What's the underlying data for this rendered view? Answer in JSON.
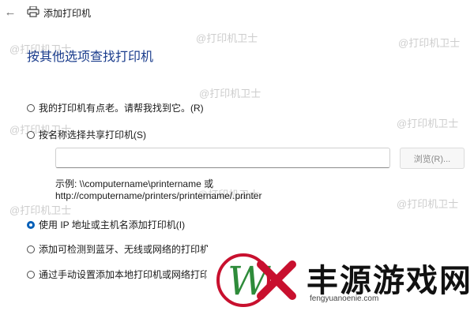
{
  "window": {
    "title": "添加打印机",
    "back_icon": "back-arrow-icon",
    "title_icon": "printer-icon"
  },
  "heading": "按其他选项查找打印机",
  "options": [
    {
      "label": "我的打印机有点老。请帮我找到它。(R)",
      "checked": false
    },
    {
      "label": "按名称选择共享打印机(S)",
      "checked": false
    },
    {
      "label": "使用 IP 地址或主机名添加打印机(I)",
      "checked": true
    },
    {
      "label": "添加可检测到蓝牙、无线或网络的打印机",
      "checked": false
    },
    {
      "label": "通过手动设置添加本地打印机或网络打印机",
      "checked": false
    }
  ],
  "shared_printer": {
    "input_value": "",
    "browse_label": "浏览(R)...",
    "example_line1": "示例: \\\\computername\\printername 或",
    "example_line2": "http://computername/printers/printername/.printer"
  },
  "watermark_text": "@打印机卫士",
  "overlay_logo": {
    "text": "丰源游戏网",
    "url": "fengyuanoenie.com"
  },
  "colors": {
    "heading": "#1a3c8c",
    "accent": "#005fb8",
    "logo_red": "#c8102e",
    "logo_green": "#2e8b3a"
  }
}
